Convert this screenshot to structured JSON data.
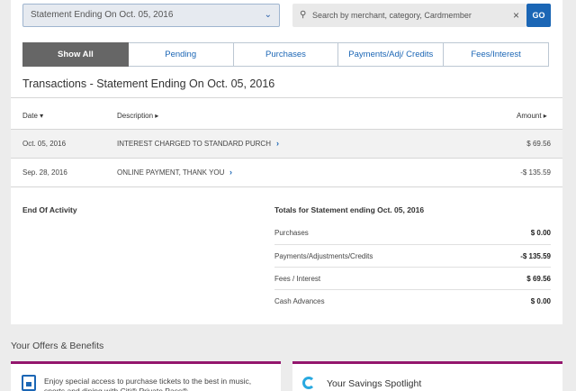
{
  "statement_select": {
    "value": "Statement Ending On Oct. 05, 2016"
  },
  "search": {
    "placeholder": "Search by merchant, category, Cardmember",
    "go_label": "GO"
  },
  "tabs": [
    {
      "label": "Show All"
    },
    {
      "label": "Pending"
    },
    {
      "label": "Purchases"
    },
    {
      "label": "Payments/Adj/ Credits"
    },
    {
      "label": "Fees/Interest"
    }
  ],
  "transactions": {
    "title": "Transactions - Statement Ending On Oct. 05, 2016",
    "headers": {
      "date": "Date ▾",
      "description": "Description ▸",
      "amount": "Amount ▸"
    },
    "rows": [
      {
        "date": "Oct. 05, 2016",
        "description": "INTEREST CHARGED TO STANDARD PURCH",
        "amount": "$ 69.56"
      },
      {
        "date": "Sep. 28, 2016",
        "description": "ONLINE PAYMENT, THANK YOU",
        "amount": "-$ 135.59"
      }
    ]
  },
  "summary": {
    "end_label": "End Of Activity",
    "totals_title": "Totals for Statement ending Oct. 05, 2016",
    "rows": [
      {
        "label": "Purchases",
        "value": "$ 0.00"
      },
      {
        "label": "Payments/Adjustments/Credits",
        "value": "-$ 135.59"
      },
      {
        "label": "Fees / Interest",
        "value": "$ 69.56"
      },
      {
        "label": "Cash Advances",
        "value": "$ 0.00"
      }
    ]
  },
  "offers": {
    "title": "Your Offers & Benefits",
    "card1_text": "Enjoy special access to purchase tickets to the best in music, sports and dining with Citi® Private Pass®",
    "card2_text": "Your Savings Spotlight"
  },
  "colors": {
    "primary_blue": "#1b66b5",
    "offer_accent": "#93166d",
    "active_tab": "#666666"
  }
}
